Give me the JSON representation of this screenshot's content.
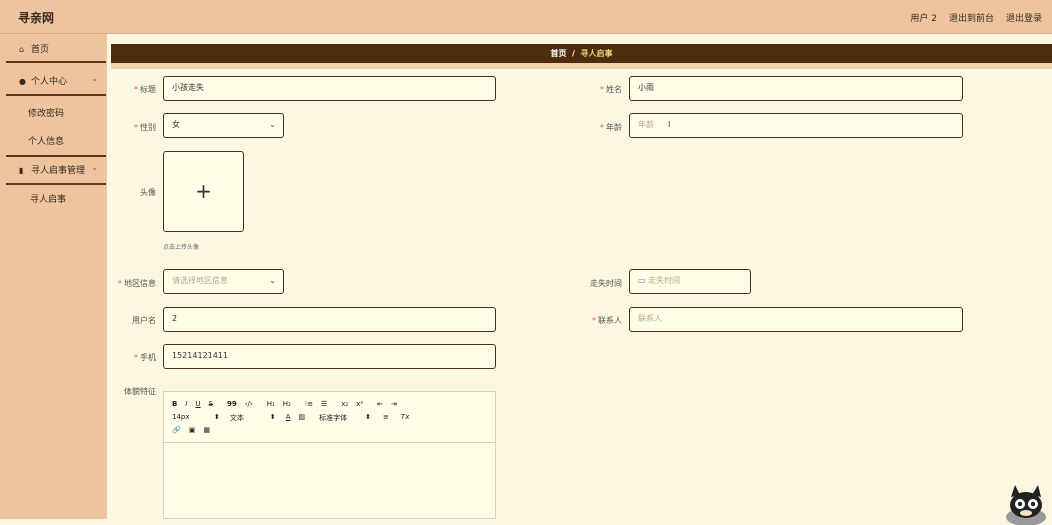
{
  "header": {
    "brand": "寻亲网",
    "user": "用户 2",
    "frontend_link": "退出到前台",
    "logout_link": "退出登录"
  },
  "sidebar": {
    "home": "首页",
    "personal_center": "个人中心",
    "change_password": "修改密码",
    "personal_info": "个人信息",
    "notice_mgmt": "寻人启事管理",
    "notice": "寻人启事"
  },
  "breadcrumb": {
    "home": "首页",
    "separator": "/",
    "current": "寻人启事"
  },
  "form": {
    "title_label": "标题",
    "title_value": "小孩走失",
    "name_label": "姓名",
    "name_value": "小雨",
    "gender_label": "性别",
    "gender_value": "女",
    "age_label": "年龄",
    "age_placeholder": "年龄",
    "avatar_label": "头像",
    "avatar_plus": "+",
    "avatar_hint": "点击上传头像",
    "region_label": "地区信息",
    "region_placeholder": "请选择地区信息",
    "lost_time_label": "走失时间",
    "lost_time_placeholder": "走失时间",
    "username_label": "用户名",
    "username_value": "2",
    "contact_label": "联系人",
    "contact_placeholder": "联系人",
    "phone_label": "手机",
    "phone_value": "15214121411",
    "features_label": "体貌特征"
  },
  "editor_toolbar": {
    "bold": "B",
    "italic": "I",
    "underline": "U",
    "strike": "S",
    "quote": "99",
    "code": "‹/›",
    "h1": "H₁",
    "h2": "H₂",
    "ordered_list": "⁝≡",
    "bullet_list": "☰",
    "subscript": "x₂",
    "superscript": "x²",
    "outdent": "⇤",
    "indent": "⇥",
    "font_size": "14px",
    "text_type": "文本",
    "font_color": "A",
    "bg_color": "▨",
    "font_family": "标准字体",
    "align": "≡",
    "clear_format": "Tx",
    "link": "🔗",
    "image": "▣",
    "table": "▦",
    "updown": "⬍"
  },
  "colors": {
    "header_bg": "#edc49f",
    "crumb_bg": "#4e2c0c",
    "page_bg": "#fbf7e0",
    "input_border": "#4a2f14"
  }
}
